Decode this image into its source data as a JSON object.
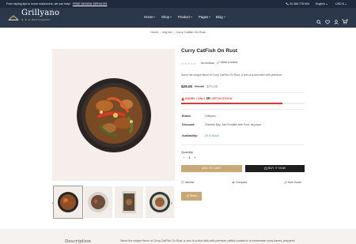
{
  "topbar": {
    "promo": "From styling tips to home makeovers, we can help!",
    "promo_link": "FREE DESIGN SERVICES",
    "phone": "04 366 778 694",
    "language": "English",
    "currency": "USD $"
  },
  "header": {
    "logo_title": "Grillyano",
    "logo_subtitle": "★ ★ ★  RESTAURANT",
    "nav": [
      "Home",
      "Shop",
      "Product",
      "Pages",
      "Blog"
    ],
    "cart_count": "0"
  },
  "breadcrumb": [
    "Home",
    "legi ket",
    "Curry Catfish On Rust"
  ],
  "product": {
    "title": "Curry CatFish On Rust",
    "stars": "★★★★★",
    "reviews": "No reviews",
    "write_review": "Write a review",
    "description": "Savor the unique flavor of Curry CatFish On Rust, a one-of-a-kind dish with premium.",
    "price": "$29.00",
    "old_price_1": "Rs.48",
    "old_price_2": "$75.00",
    "hurry_prefix": "HURRY ! ONLY",
    "stock_left": "30",
    "hurry_suffix": "LEFT IN STOCK.",
    "stock_fill": 0.82,
    "meta": [
      {
        "label": "Brand:",
        "value": "Grillyano"
      },
      {
        "label": "Discount:",
        "value": "Chinese Bay, Asri Pondtile free Pool, seg lepe"
      },
      {
        "label": "Availability:",
        "value": "33 In Stock"
      }
    ],
    "quantity_label": "Quantity",
    "quantity_value": "1",
    "add_to_cart": "ADD TO CART",
    "buy_now": "BUY IT NOW",
    "wishlist": "wishlist",
    "compare": "Compare",
    "size_guide": "Size Guide",
    "share": "Share"
  },
  "bottom": {
    "tab": "Description",
    "text": "Savor the unique flavor of Curry CatFish On Rust, a one-of-a-kind dish with premium catfish cooked in a homemade curry-based, prepared"
  },
  "colors": {
    "topbar": "#1f2b3d",
    "header": "#2b374a",
    "accent": "#c8a877",
    "hurry": "#e0413b",
    "stock_bar": "#d63b36",
    "in_stock": "#3aa55c"
  }
}
